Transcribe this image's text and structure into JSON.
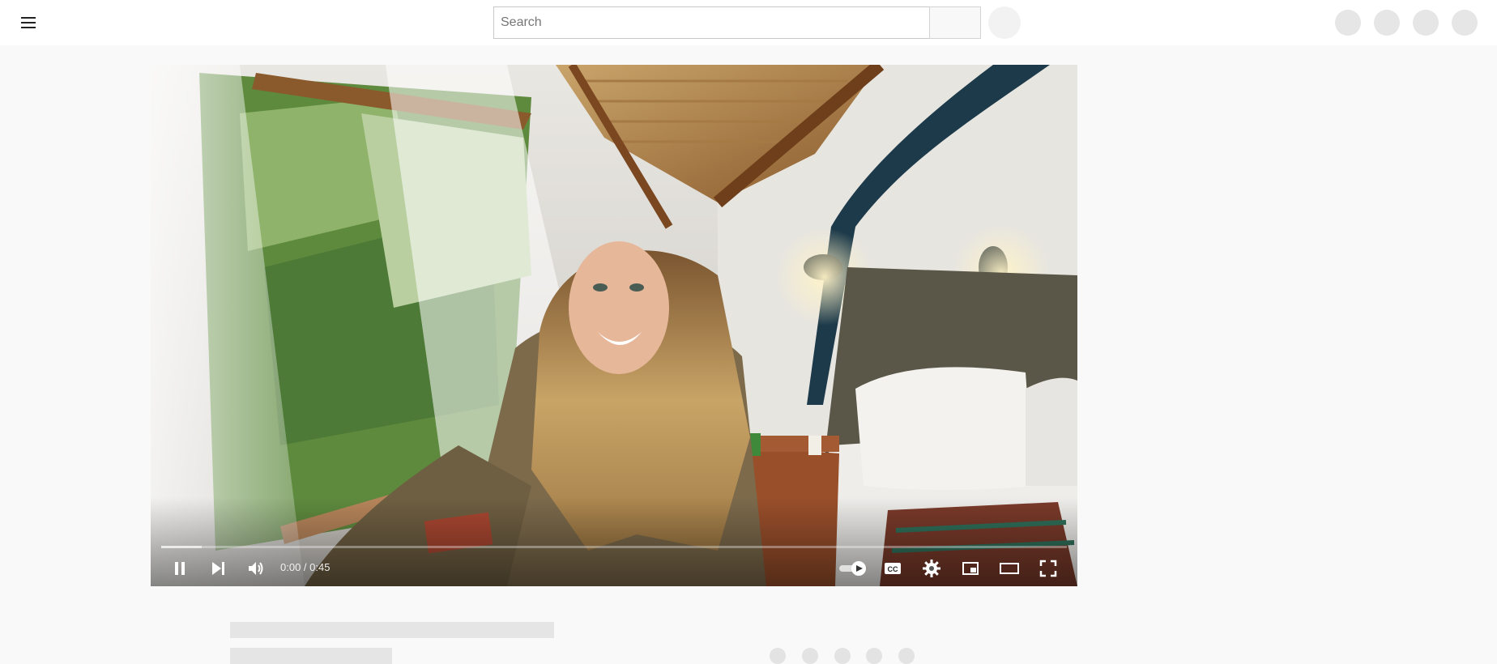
{
  "search": {
    "placeholder": "Search"
  },
  "player": {
    "time_current": "0:00",
    "time_separator": " / ",
    "time_duration": "0:45",
    "progress_fraction": 0.045
  },
  "icons": {
    "menu": "menu-icon",
    "pause": "pause-icon",
    "next": "next-icon",
    "volume": "volume-icon",
    "autoplay": "autoplay-toggle-icon",
    "captions": "cc-icon",
    "settings": "gear-icon",
    "miniplayer": "miniplayer-icon",
    "theater": "theater-mode-icon",
    "fullscreen": "fullscreen-icon"
  },
  "colors": {
    "page_bg": "#f9f9f9",
    "topbar_bg": "#ffffff",
    "control_icon": "#ffffff",
    "skeleton": "#e5e5e5"
  }
}
